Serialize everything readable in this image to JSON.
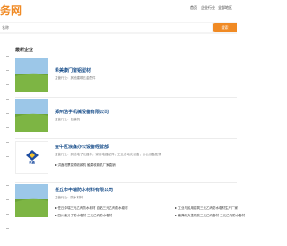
{
  "header": {
    "logo_text": "务网",
    "nav": [
      "首页",
      "企业行业",
      "全部地区"
    ]
  },
  "search": {
    "value": "名称",
    "button_label": "搜索"
  },
  "section": {
    "title": "最新企业"
  },
  "companies": [
    {
      "name": "希美康门窗铝型材",
      "meta": "主营行业：其他建筑五金配件",
      "products": []
    },
    {
      "name": "郑州浩宇机械设备有限公司",
      "meta": "主营行业：包装机",
      "products": []
    },
    {
      "name": "金牛区浪鑫办公设备经营部",
      "meta": "主营行业：其他电子元器件，家用电器配件，工业自动化设备，办公设备配件",
      "products": [
        "洪鑫税票变频收款机 触摸收款机厂家直销"
      ]
    },
    {
      "name": "任丘市中瑞防水材料有限公司",
      "meta": "主营行业：防水材料",
      "products": [
        "任丘中瑞三元乙丙防水卷材 自粘三元乙丙防水卷材",
        "工业与民用建筑三元乙丙防水卷材生产厂家",
        "四川高分子防水卷材 三元乙丙防水卷材",
        "高弹耐久性橡胶三元乙丙卷材 三元乙丙防水卷材"
      ]
    }
  ],
  "thumb_badge": "浪鑫",
  "colors": {
    "accent": "#f08a24",
    "company_name": "#1a4f8b"
  }
}
